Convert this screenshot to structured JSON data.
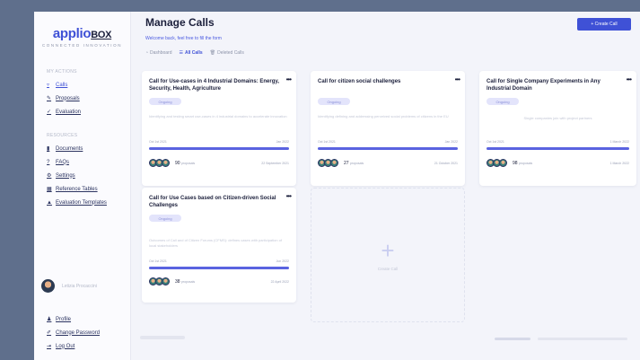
{
  "logo": {
    "name": "applio",
    "suffix": "BOX",
    "tagline": "CONNECTED INNOVATION"
  },
  "sidebar": {
    "section1": "MY ACTIONS",
    "items1": [
      {
        "label": "Calls",
        "icon": "filter-icon"
      },
      {
        "label": "Proposals",
        "icon": "pencil-icon"
      },
      {
        "label": "Evaluation",
        "icon": "check-icon"
      }
    ],
    "section2": "RESOURCES",
    "items2": [
      {
        "label": "Documents",
        "icon": "document-icon"
      },
      {
        "label": "FAQs",
        "icon": "question-icon"
      },
      {
        "label": "Settings",
        "icon": "gear-icon"
      },
      {
        "label": "Reference Tables",
        "icon": "table-icon"
      },
      {
        "label": "Evaluation Templates",
        "icon": "template-icon"
      }
    ],
    "user_name": "Letizia Procaccini",
    "account": [
      {
        "label": "Profile",
        "icon": "user-icon"
      },
      {
        "label": "Change Password",
        "icon": "key-icon"
      },
      {
        "label": "Log Out",
        "icon": "logout-icon"
      }
    ]
  },
  "header": {
    "title": "Manage Calls",
    "subtitle": "Welcome back, feel free to fill the form",
    "create_label": "+ Create Call"
  },
  "filters": [
    {
      "label": "Dashboard",
      "icon": "dashboard-icon"
    },
    {
      "label": "All Calls",
      "icon": "list-icon"
    },
    {
      "label": "Deleted Calls",
      "icon": "trash-icon"
    }
  ],
  "cards": [
    {
      "title": "Call for Use-cases in 4 Industrial Domains: Energy, Security, Health, Agriculture",
      "status": "Ongoing",
      "description": "Identifying and testing smart use-cases in 4 industrial domains to accelerate innovation",
      "start": "Oct 1st 2021",
      "end": "Jan 2022",
      "progress": 1.0,
      "count": "90",
      "count_label": "proposals",
      "modified": "22 September 2021"
    },
    {
      "title": "Call for citizen social challenges",
      "status": "Ongoing",
      "description": "Identifying defining and addressing perceived social problems of citizens in the EU",
      "start": "Oct 1st 2021",
      "end": "Jan 2022",
      "progress": 1.0,
      "count": "27",
      "count_label": "proposals",
      "modified": "21 October 2021"
    },
    {
      "title": "Call for Single Company Experiments in Any Industrial Domain",
      "status": "Ongoing",
      "description": "Single companies join with project partners",
      "start": "Oct 1st 2021",
      "end": "1 March 2022",
      "progress": 1.0,
      "count": "98",
      "count_label": "proposals",
      "modified": "1 March 2022"
    },
    {
      "title": "Call for Use Cases based on Citizen-driven Social Challenges",
      "status": "Ongoing",
      "description": "Outcomes of Call and of Citizen Forums (CFMS): defines cases with participation of local stakeholders",
      "start": "Oct 1st 2021",
      "end": "Jun 2022",
      "progress": 1.0,
      "count": "38",
      "count_label": "proposals",
      "modified": "22 April 2022"
    }
  ],
  "create_card_label": "Create Call",
  "colors": {
    "accent": "#3f51d6",
    "badge_bg": "#e3e4fb"
  }
}
